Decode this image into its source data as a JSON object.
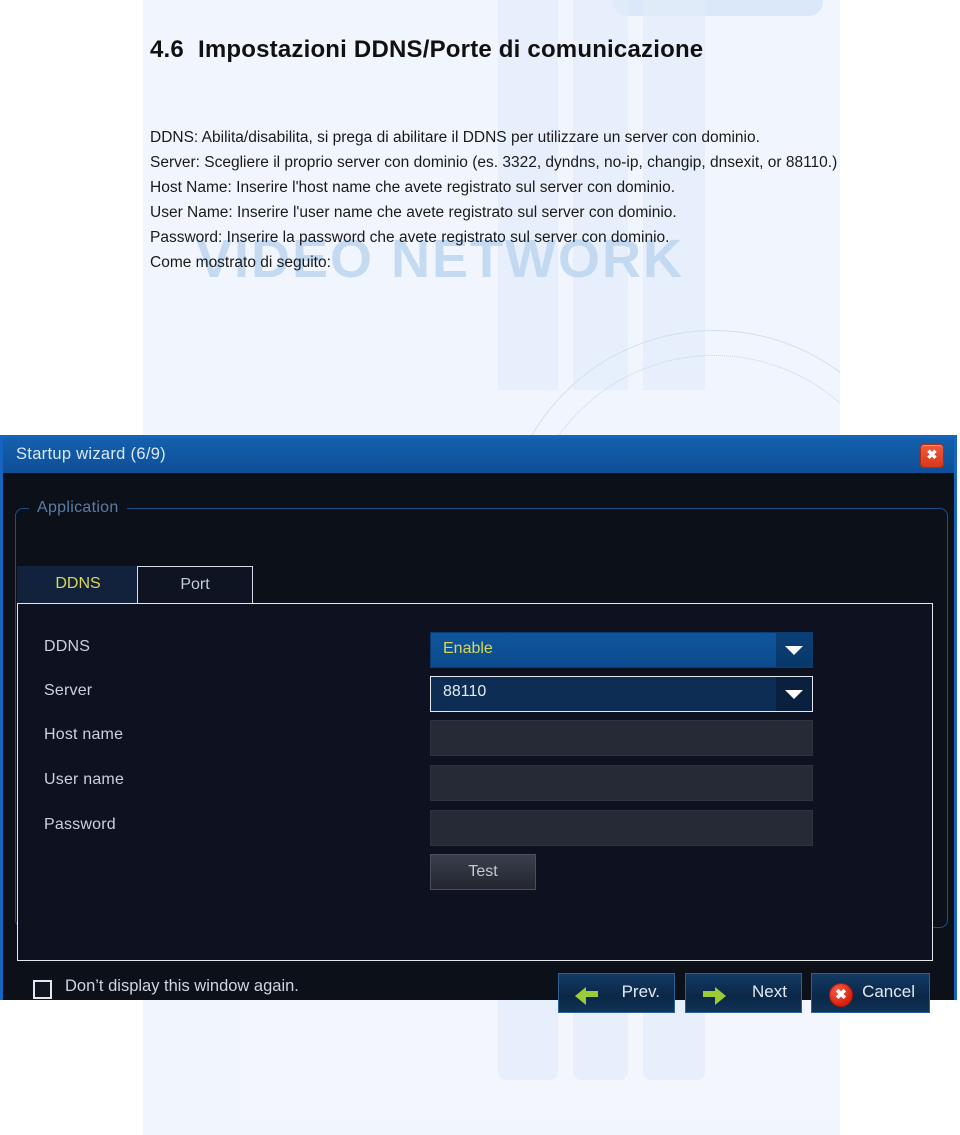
{
  "document": {
    "heading_number": "4.6",
    "heading_text": "Impostazioni DDNS/Porte di comunicazione",
    "watermark": "VIDEO NETWORK",
    "paragraphs": [
      "DDNS: Abilita/disabilita, si prega di abilitare il DDNS per utilizzare un server con dominio.",
      "Server: Scegliere il proprio server con dominio (es. 3322, dyndns, no-ip, changip, dnsexit, or 88110.)",
      "Host Name: Inserire l'host name che avete registrato sul server con dominio.",
      "User Name: Inserire l'user name che avete registrato sul server con dominio.",
      "Password: Inserire la password che avete registrato sul server con dominio.",
      "Come mostrato di seguito:"
    ]
  },
  "wizard": {
    "title": "Startup wizard (6/9)",
    "close_icon": "close-icon",
    "group_legend": "Application",
    "tabs": [
      {
        "label": "DDNS",
        "active": true
      },
      {
        "label": "Port",
        "active": false
      }
    ],
    "fields": [
      {
        "label": "DDNS",
        "type": "select",
        "value": "Enable",
        "highlighted": true
      },
      {
        "label": "Server",
        "type": "select",
        "value": "88110",
        "highlighted": false
      },
      {
        "label": "Host name",
        "type": "text",
        "value": ""
      },
      {
        "label": "User name",
        "type": "text",
        "value": ""
      },
      {
        "label": "Password",
        "type": "password",
        "value": ""
      }
    ],
    "test_button": "Test",
    "checkbox": {
      "label": "Don’t display this window again.",
      "checked": false
    },
    "buttons": [
      {
        "id": "prev",
        "label": "Prev.",
        "icon": "arrow-left-icon"
      },
      {
        "id": "next",
        "label": "Next",
        "icon": "arrow-right-icon"
      },
      {
        "id": "cancel",
        "label": "Cancel",
        "icon": "cancel-circle-icon"
      }
    ]
  },
  "colors": {
    "title_bar": "#1460ad",
    "accent_blue": "#1565c0",
    "tab_active_text": "#d9d659",
    "select_value_text": "#d6d955",
    "arrow_green": "#9bcc33",
    "cancel_red": "#d8200c"
  }
}
